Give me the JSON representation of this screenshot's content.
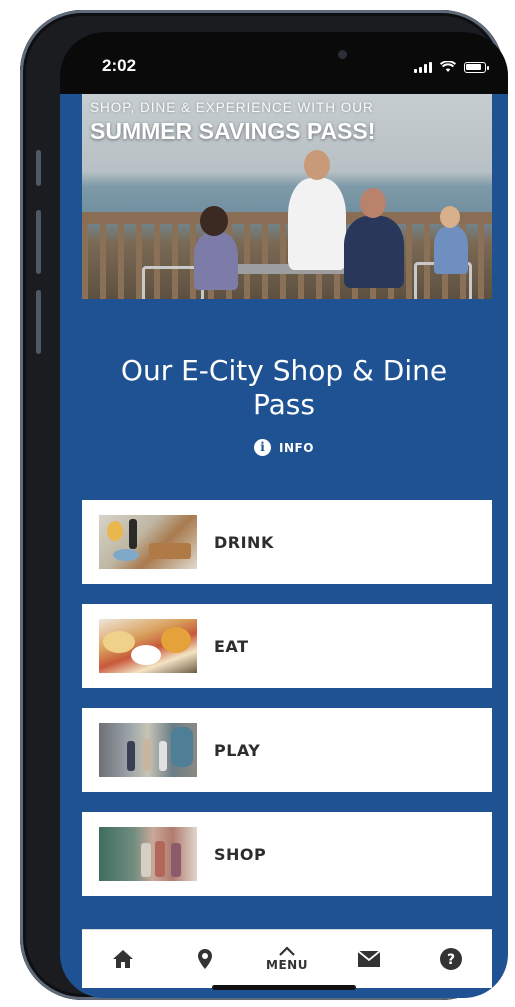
{
  "status_bar": {
    "time": "2:02"
  },
  "hero": {
    "caption_line1": "SHOP, DINE & EXPERIENCE WITH OUR",
    "caption_line2": "SUMMER SAVINGS PASS!"
  },
  "page": {
    "title_line1": "Our E-City Shop & Dine",
    "title_line2": "Pass",
    "info_label": "INFO"
  },
  "categories": [
    {
      "label": "DRINK"
    },
    {
      "label": "EAT"
    },
    {
      "label": "PLAY"
    },
    {
      "label": "SHOP"
    }
  ],
  "bottom_nav": {
    "items": [
      {
        "icon": "home-icon"
      },
      {
        "icon": "map-pin-icon"
      },
      {
        "icon": "chevron-up-icon",
        "label": "MENU"
      },
      {
        "icon": "mail-icon"
      },
      {
        "icon": "help-icon"
      }
    ]
  },
  "colors": {
    "brand_blue": "#1f5293",
    "card_bg": "#ffffff",
    "text_dark": "#2d2d2d"
  }
}
